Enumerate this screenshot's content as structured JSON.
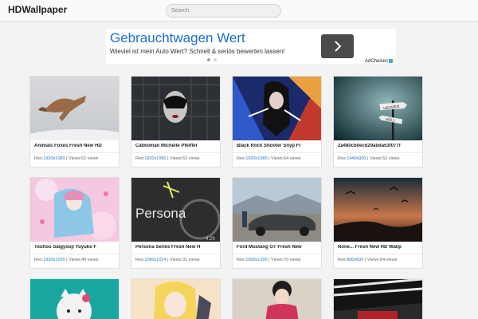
{
  "header": {
    "brand": "HDWallpaper",
    "search_placeholder": "Search"
  },
  "ad": {
    "title": "Gebrauchtwagen Wert",
    "subtitle": "Wieviel ist mein Auto Wert? Schnell & seriös bewerten lassen!",
    "button_icon": "chevron-right-icon",
    "adchoices": "AdChoices",
    "dot_active_color": "#9e9e9e",
    "dot_inactive_color": "#d6d6d6"
  },
  "labels": {
    "res_prefix": "Res:",
    "views_prefix": "| Views:"
  },
  "cards": [
    {
      "title": "Animals Foxes Fresh New HD",
      "res": "1920x1080",
      "views": "62 views"
    },
    {
      "title": "Catwoman Michelle Pfeiffer",
      "res": "1920x1080",
      "views": "62 views"
    },
    {
      "title": "Black Rock Shooter Snyp Fr",
      "res": "1920x1080",
      "views": "64 views"
    },
    {
      "title": "2a480cb0ecd29abda53f077f",
      "res": "1440x900",
      "views": "52 views"
    },
    {
      "title": "Touhou Saigyouji Yuyuko F",
      "res": "1920x1200",
      "views": "49 views"
    },
    {
      "title": "Persona Series Fresh New H",
      "res": "1280x1024",
      "views": "31 views"
    },
    {
      "title": "Ford Mustang GT Fresh New",
      "res": "1600x1200",
      "views": "70 views"
    },
    {
      "title": "None... Fresh New HD Wallp",
      "res": "800x600",
      "views": "64 views"
    }
  ],
  "thumb_texts": {
    "sign_top": "HEAVEN",
    "sign_bottom": "HELL",
    "persona": "Persona",
    "persona_num": "4.29"
  },
  "colors": {
    "link": "#2a79c9",
    "ad_title": "#1a6fd1"
  }
}
